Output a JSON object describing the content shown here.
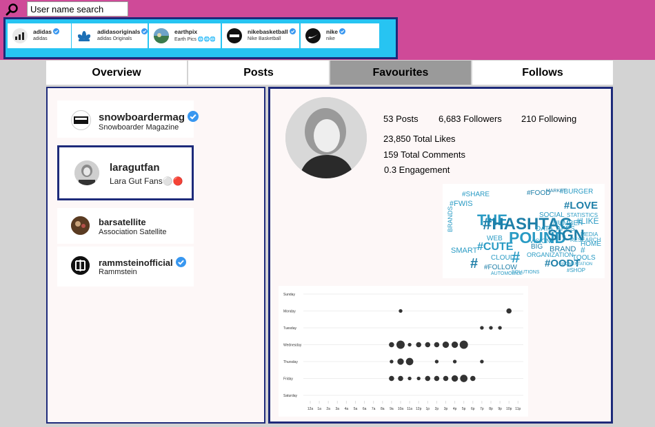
{
  "search": {
    "placeholder": "User name search",
    "value": ""
  },
  "accounts": [
    {
      "name": "adidas",
      "subtitle": "adidas",
      "verified": true
    },
    {
      "name": "adidasoriginals",
      "subtitle": "adidas Originals",
      "verified": true
    },
    {
      "name": "earthpix",
      "subtitle": "Earth Pics 🌐🌐🌐",
      "verified": false
    },
    {
      "name": "nikebasketball",
      "subtitle": "Nike Basketball",
      "verified": true
    },
    {
      "name": "nike",
      "subtitle": "nike",
      "verified": true
    }
  ],
  "tabs": [
    {
      "label": "Overview",
      "active": false
    },
    {
      "label": "Posts",
      "active": false
    },
    {
      "label": "Favourites",
      "active": true
    },
    {
      "label": "Follows",
      "active": false
    }
  ],
  "favourites": [
    {
      "username": "snowboardermag",
      "fullname": "Snowboarder Magazine",
      "verified": true,
      "selected": false
    },
    {
      "username": "laragutfan",
      "fullname": "Lara Gut Fans⚪🔴",
      "verified": false,
      "selected": true
    },
    {
      "username": "barsatellite",
      "fullname": "Association Satellite",
      "verified": false,
      "selected": false
    },
    {
      "username": "rammsteinofficial",
      "fullname": "Rammstein",
      "verified": true,
      "selected": false
    }
  ],
  "profile": {
    "posts": "53 Posts",
    "followers": "6,683 Followers",
    "following": "210 Following",
    "total_likes": "23,850 Total Likes",
    "total_comments": "159 Total Comments",
    "engagement": "0.3 Engagement"
  },
  "wordcloud_words": [
    {
      "text": "#SHARE",
      "color": "#2a9bc4"
    },
    {
      "text": "#FOOD",
      "color": "#1e7fa8"
    },
    {
      "text": "#BURGER",
      "color": "#2a9bc4"
    },
    {
      "text": "#FWIS",
      "color": "#2a9bc4"
    },
    {
      "text": "#LOVE",
      "color": "#1e7fa8"
    },
    {
      "text": "THE",
      "color": "#2a9bc4"
    },
    {
      "text": "#HASHTAG",
      "color": "#1e7fa8"
    },
    {
      "text": "#LIKE",
      "color": "#2a9bc4"
    },
    {
      "text": "POUND",
      "color": "#2a9bc4"
    },
    {
      "text": "SIGN",
      "color": "#1e7fa8"
    },
    {
      "text": "#CUTE",
      "color": "#2a9bc4"
    },
    {
      "text": "#FOLLOW",
      "color": "#1e7fa8"
    },
    {
      "text": "#OODT",
      "color": "#1e7fa8"
    },
    {
      "text": "#",
      "color": "#1e7fa8"
    },
    {
      "text": "#",
      "color": "#2a9bc4"
    },
    {
      "text": "#",
      "color": "#2a9bc4"
    },
    {
      "text": "WEB",
      "color": "#2a9bc4"
    },
    {
      "text": "SMART",
      "color": "#2a9bc4"
    },
    {
      "text": "CLOUD",
      "color": "#2a9bc4"
    },
    {
      "text": "BRAND",
      "color": "#1e7fa8"
    },
    {
      "text": "HOME",
      "color": "#2a9bc4"
    },
    {
      "text": "APPS",
      "color": "#2a9bc4"
    },
    {
      "text": "NUMBER",
      "color": "#2a9bc4"
    },
    {
      "text": "SOCIAL",
      "color": "#2a9bc4"
    },
    {
      "text": "STATISTICS",
      "color": "#2a9bc4"
    },
    {
      "text": "MEDIA",
      "color": "#2a9bc4"
    },
    {
      "text": "DATA",
      "color": "#2a9bc4"
    },
    {
      "text": "BIG",
      "color": "#1e7fa8"
    },
    {
      "text": "VISION",
      "color": "#2a9bc4"
    },
    {
      "text": "TOOLS",
      "color": "#2a9bc4"
    },
    {
      "text": "RESEARCH",
      "color": "#2a9bc4"
    },
    {
      "text": "ORGANIZATION",
      "color": "#2a9bc4"
    },
    {
      "text": "SOLUTIONS",
      "color": "#2a9bc4"
    },
    {
      "text": "#SHOP",
      "color": "#2a9bc4"
    },
    {
      "text": "MARKET",
      "color": "#1e7fa8"
    },
    {
      "text": "AUTOMOBILE",
      "color": "#2a9bc4"
    },
    {
      "text": "SEGMENTATION",
      "color": "#2a9bc4"
    },
    {
      "text": "BRANDS",
      "color": "#2a9bc4"
    }
  ],
  "chart_data": {
    "type": "scatter",
    "title": "",
    "xlabel": "",
    "ylabel": "",
    "grid": true,
    "x_categories": [
      "12a",
      "1a",
      "2a",
      "3a",
      "4a",
      "5a",
      "6a",
      "7a",
      "8a",
      "9a",
      "10a",
      "11a",
      "12p",
      "1p",
      "2p",
      "3p",
      "4p",
      "5p",
      "6p",
      "7p",
      "8p",
      "9p",
      "10p",
      "11p"
    ],
    "y_categories": [
      "Sunday",
      "Monday",
      "Tuesday",
      "Wednesday",
      "Thursday",
      "Friday",
      "Saturday"
    ],
    "points": [
      {
        "day": "Monday",
        "hour": "10a",
        "count": 1
      },
      {
        "day": "Monday",
        "hour": "10p",
        "count": 2
      },
      {
        "day": "Tuesday",
        "hour": "7p",
        "count": 1
      },
      {
        "day": "Tuesday",
        "hour": "8p",
        "count": 1
      },
      {
        "day": "Tuesday",
        "hour": "9p",
        "count": 1
      },
      {
        "day": "Wednesday",
        "hour": "9a",
        "count": 2
      },
      {
        "day": "Wednesday",
        "hour": "10a",
        "count": 5
      },
      {
        "day": "Wednesday",
        "hour": "11a",
        "count": 1
      },
      {
        "day": "Wednesday",
        "hour": "12p",
        "count": 2
      },
      {
        "day": "Wednesday",
        "hour": "1p",
        "count": 2
      },
      {
        "day": "Wednesday",
        "hour": "2p",
        "count": 2
      },
      {
        "day": "Wednesday",
        "hour": "3p",
        "count": 3
      },
      {
        "day": "Wednesday",
        "hour": "4p",
        "count": 3
      },
      {
        "day": "Wednesday",
        "hour": "5p",
        "count": 5
      },
      {
        "day": "Thursday",
        "hour": "9a",
        "count": 1
      },
      {
        "day": "Thursday",
        "hour": "10a",
        "count": 3
      },
      {
        "day": "Thursday",
        "hour": "11a",
        "count": 4
      },
      {
        "day": "Thursday",
        "hour": "2p",
        "count": 1
      },
      {
        "day": "Thursday",
        "hour": "4p",
        "count": 1
      },
      {
        "day": "Thursday",
        "hour": "7p",
        "count": 1
      },
      {
        "day": "Friday",
        "hour": "9a",
        "count": 2
      },
      {
        "day": "Friday",
        "hour": "10a",
        "count": 2
      },
      {
        "day": "Friday",
        "hour": "11a",
        "count": 1
      },
      {
        "day": "Friday",
        "hour": "12p",
        "count": 1
      },
      {
        "day": "Friday",
        "hour": "1p",
        "count": 2
      },
      {
        "day": "Friday",
        "hour": "2p",
        "count": 2
      },
      {
        "day": "Friday",
        "hour": "3p",
        "count": 2
      },
      {
        "day": "Friday",
        "hour": "4p",
        "count": 3
      },
      {
        "day": "Friday",
        "hour": "5p",
        "count": 4
      },
      {
        "day": "Friday",
        "hour": "6p",
        "count": 2
      }
    ]
  }
}
